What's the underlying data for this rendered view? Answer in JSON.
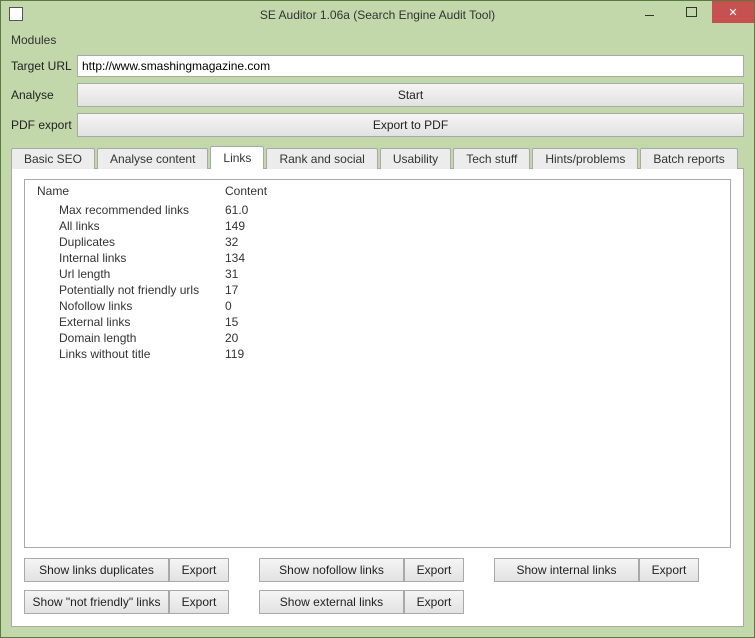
{
  "window": {
    "title": "SE Auditor 1.06a (Search Engine Audit Tool)"
  },
  "menubar": {
    "modules": "Modules"
  },
  "form": {
    "target_label": "Target URL",
    "target_value": "http://www.smashingmagazine.com",
    "analyse_label": "Analyse",
    "start_label": "Start",
    "pdf_label": "PDF export",
    "export_pdf_label": "Export to PDF"
  },
  "tabs": [
    "Basic SEO",
    "Analyse content",
    "Links",
    "Rank and social",
    "Usability",
    "Tech stuff",
    "Hints/problems",
    "Batch reports"
  ],
  "active_tab_index": 2,
  "table": {
    "headers": {
      "name": "Name",
      "content": "Content"
    },
    "rows": [
      {
        "name": "Max recommended links",
        "content": "61.0"
      },
      {
        "name": "All links",
        "content": "149"
      },
      {
        "name": "Duplicates",
        "content": "32"
      },
      {
        "name": "Internal links",
        "content": "134"
      },
      {
        "name": "Url length",
        "content": "31"
      },
      {
        "name": "Potentially not friendly urls",
        "content": "17"
      },
      {
        "name": "Nofollow links",
        "content": "0"
      },
      {
        "name": "External links",
        "content": "15"
      },
      {
        "name": "Domain length",
        "content": "20"
      },
      {
        "name": "Links without title",
        "content": "119"
      }
    ]
  },
  "buttons": {
    "show_dup": "Show links duplicates",
    "show_nofollow": "Show nofollow links",
    "show_internal": "Show internal links",
    "show_notfriendly": "Show \"not friendly\" links",
    "show_external": "Show external links",
    "export": "Export"
  }
}
